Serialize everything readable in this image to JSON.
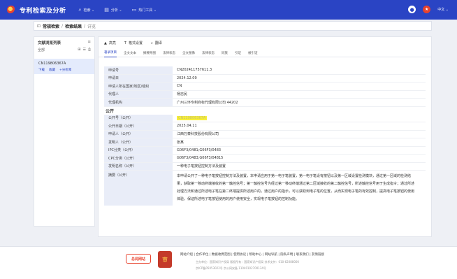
{
  "header": {
    "brand": "专利检索及分析",
    "nav": [
      {
        "icon": "search-icon",
        "glyph": "⌕",
        "label": "检索 ⌄"
      },
      {
        "icon": "chart-icon",
        "glyph": "▤",
        "label": "分析 ⌄"
      },
      {
        "icon": "folder-icon",
        "glyph": "▭",
        "label": "热门工具 ⌄"
      }
    ],
    "lang": "中文 ⌄"
  },
  "breadcrumb": {
    "home": "常规检索",
    "mid": "检索结果",
    "current": "详览"
  },
  "left_panel": {
    "title": "文献浏览列表",
    "count": "全部",
    "item_number": "CN119806367A",
    "actions": [
      "下载",
      "收藏",
      "+分析库"
    ]
  },
  "toolbar": {
    "items": [
      "高亮",
      "格式设置",
      "翻译"
    ]
  },
  "tabs": [
    "著录项目",
    "全文文本",
    "摘要附图",
    "法律状态",
    "全文图像",
    "法律状态",
    "同族",
    "引证",
    "被引证"
  ],
  "biblio": [
    {
      "k": "申请号",
      "v": "CN202411757611.3"
    },
    {
      "k": "申请日",
      "v": "2024.12.09"
    },
    {
      "k": "申请人所在国家/地区/组织",
      "v": "CN"
    },
    {
      "k": "代理人",
      "v": "杨志民"
    },
    {
      "k": "代理机构",
      "v": "广州三环专利商标代理有限公司 44202"
    }
  ],
  "section_label": "公开",
  "pub": [
    {
      "k": "公开号（公开）",
      "v": "CN119806367A",
      "highlight": true
    },
    {
      "k": "公开日期（公开）",
      "v": "2025.04.11"
    },
    {
      "k": "申请人（公开）",
      "v": "江西万泰科技股份有限公司"
    },
    {
      "k": "发明人（公开）",
      "v": "张某"
    },
    {
      "k": "IPC分类（公开）",
      "v": "G06F3/0481;G06F3/0483"
    },
    {
      "k": "CPC分类（公开）",
      "v": "G06F3/0483;G06F3/04815"
    },
    {
      "k": "发明名称（公开）",
      "v": "一种电子笔按钮控制方法及装置"
    }
  ],
  "abstract": {
    "k": "摘要（公开）",
    "v": "本申请公开了一种电子笔按钮控制方法及装置，本申请应用于第一电子笔装置，第一电子笔设有按钮以及第一区域设置检测模块，通过第一区域的检测结果，获取第一移动终端接收的第一触控信号；第一触控信号为经过第一移动终端通过第二区域接收的第二触控信号，所述触控信号用于生成指令；通过所述处理方法和通过所述电子笔在第二终端提供所述用户的，通过用户的指示，可以获取到电子笔的位置，从而实现电子笔的有效控制，提高电子笔按钮的使用体验，保证所述电子笔按钮使用的用户使用安全，实现电子笔按钮的控制功能。"
  },
  "footer": {
    "logo1": "总局网站",
    "logo2": "审",
    "links": "网站介绍 | 合作单位 | 数据收费范围 | 使用协议 | 帮助中心 | 网站导航 | 隐私声明 | 联系我们 | 友情链接",
    "line1": "主办单位：国家知识产权局   版权所有：国家知识产权局   技术支持：010-62088000",
    "line2": "京ICP备05053022号   京公网安备 11040102700134号"
  }
}
